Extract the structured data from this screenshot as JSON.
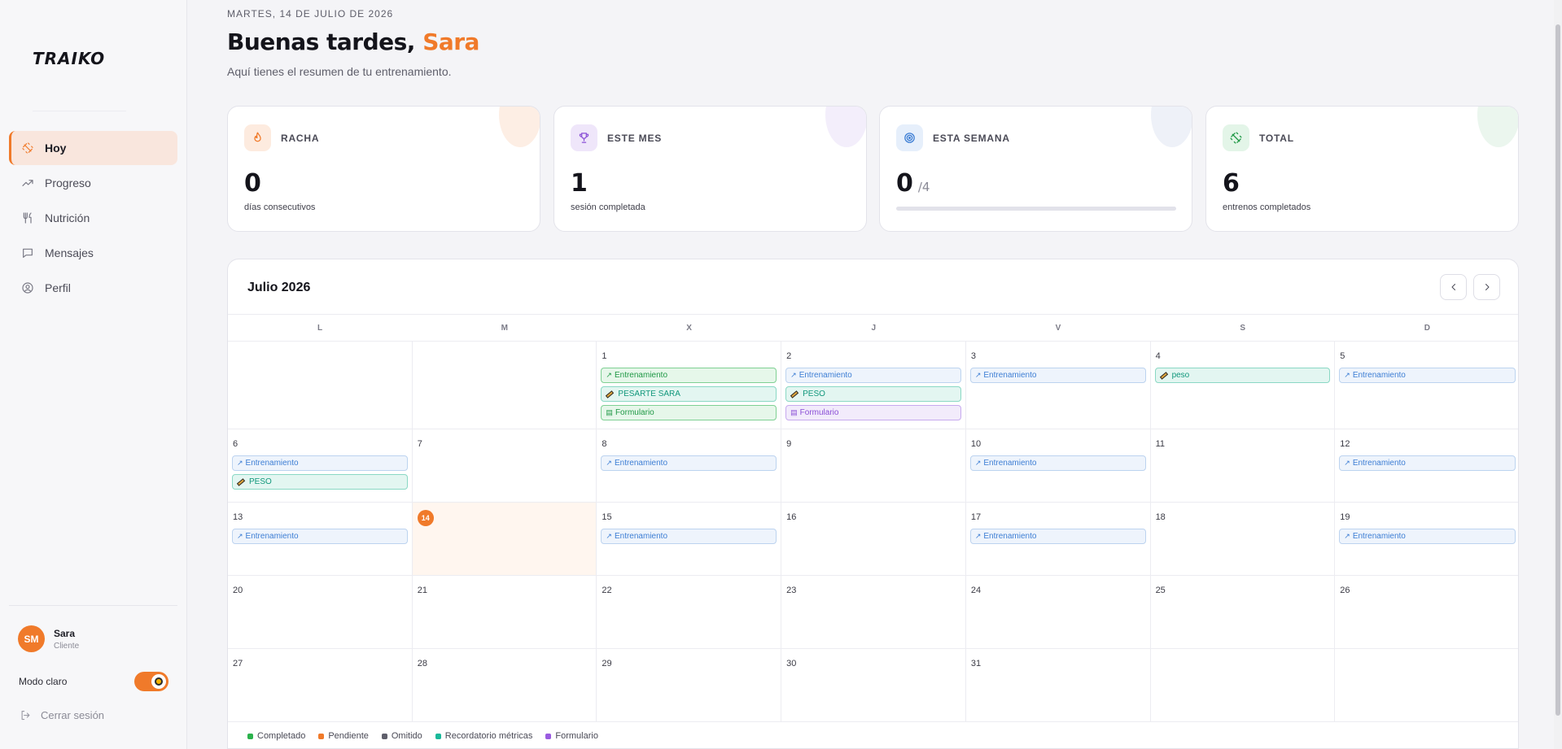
{
  "app": {
    "logo": "TRAIKO"
  },
  "sidebar": {
    "items": [
      {
        "label": "Hoy",
        "icon": "dumbbell-icon",
        "active": true
      },
      {
        "label": "Progreso",
        "icon": "trending-up-icon",
        "active": false
      },
      {
        "label": "Nutrición",
        "icon": "utensils-icon",
        "active": false
      },
      {
        "label": "Mensajes",
        "icon": "message-icon",
        "active": false
      },
      {
        "label": "Perfil",
        "icon": "user-circle-icon",
        "active": false
      }
    ],
    "user": {
      "initials": "SM",
      "name": "Sara",
      "role": "Cliente"
    },
    "theme_label": "Modo claro",
    "logout_label": "Cerrar sesión"
  },
  "header": {
    "date": "MARTES, 14 DE JULIO DE 2026",
    "greeting": "Buenas tardes,",
    "name": "Sara",
    "subtitle": "Aquí tienes el resumen de tu entrenamiento."
  },
  "stats": {
    "streak": {
      "title": "RACHA",
      "value": "0",
      "desc": "días consecutivos",
      "icon": "flame-icon",
      "color": "#f07a2a"
    },
    "month": {
      "title": "ESTE MES",
      "value": "1",
      "desc": "sesión completada",
      "icon": "trophy-icon",
      "color": "#8a4fd6"
    },
    "week": {
      "title": "ESTA SEMANA",
      "value": "0",
      "of": "/4",
      "progress": 0,
      "icon": "target-icon",
      "color": "#3d7ed4"
    },
    "total": {
      "title": "TOTAL",
      "value": "6",
      "desc": "entrenos completados",
      "icon": "dumbbell-icon",
      "color": "#1f9845"
    }
  },
  "calendar": {
    "title": "Julio 2026",
    "weekdays": [
      "L",
      "M",
      "X",
      "J",
      "V",
      "S",
      "D"
    ],
    "days": [
      {
        "n": "",
        "events": []
      },
      {
        "n": "",
        "events": []
      },
      {
        "n": "1",
        "events": [
          {
            "type": "done",
            "label": "Entrenamiento"
          },
          {
            "type": "metric",
            "label": "PESARTE SARA"
          },
          {
            "type": "done-form",
            "label": "Formulario"
          }
        ]
      },
      {
        "n": "2",
        "events": [
          {
            "type": "train",
            "label": "Entrenamiento"
          },
          {
            "type": "metric",
            "label": "PESO"
          },
          {
            "type": "form",
            "label": "Formulario"
          }
        ]
      },
      {
        "n": "3",
        "events": [
          {
            "type": "train",
            "label": "Entrenamiento"
          }
        ]
      },
      {
        "n": "4",
        "events": [
          {
            "type": "metric",
            "label": "peso"
          }
        ]
      },
      {
        "n": "5",
        "events": [
          {
            "type": "train",
            "label": "Entrenamiento"
          }
        ]
      },
      {
        "n": "6",
        "events": [
          {
            "type": "train",
            "label": "Entrenamiento"
          },
          {
            "type": "metric",
            "label": "PESO"
          }
        ]
      },
      {
        "n": "7",
        "events": []
      },
      {
        "n": "8",
        "events": [
          {
            "type": "train",
            "label": "Entrenamiento"
          }
        ]
      },
      {
        "n": "9",
        "events": []
      },
      {
        "n": "10",
        "events": [
          {
            "type": "train",
            "label": "Entrenamiento"
          }
        ]
      },
      {
        "n": "11",
        "events": []
      },
      {
        "n": "12",
        "events": [
          {
            "type": "train",
            "label": "Entrenamiento"
          }
        ]
      },
      {
        "n": "13",
        "events": [
          {
            "type": "train",
            "label": "Entrenamiento"
          }
        ]
      },
      {
        "n": "14",
        "today": true,
        "events": []
      },
      {
        "n": "15",
        "events": [
          {
            "type": "train",
            "label": "Entrenamiento"
          }
        ]
      },
      {
        "n": "16",
        "events": []
      },
      {
        "n": "17",
        "events": [
          {
            "type": "train",
            "label": "Entrenamiento"
          }
        ]
      },
      {
        "n": "18",
        "events": []
      },
      {
        "n": "19",
        "events": [
          {
            "type": "train",
            "label": "Entrenamiento"
          }
        ]
      },
      {
        "n": "20",
        "events": []
      },
      {
        "n": "21",
        "events": []
      },
      {
        "n": "22",
        "events": []
      },
      {
        "n": "23",
        "events": []
      },
      {
        "n": "24",
        "events": []
      },
      {
        "n": "25",
        "events": []
      },
      {
        "n": "26",
        "events": []
      },
      {
        "n": "27",
        "events": []
      },
      {
        "n": "28",
        "events": []
      },
      {
        "n": "29",
        "events": []
      },
      {
        "n": "30",
        "events": []
      },
      {
        "n": "31",
        "events": []
      },
      {
        "n": "",
        "events": []
      },
      {
        "n": "",
        "events": []
      }
    ],
    "legend": [
      {
        "label": "Completado",
        "color": "#2bb24c"
      },
      {
        "label": "Pendiente",
        "color": "#f07a2a"
      },
      {
        "label": "Omitido",
        "color": "#5f5f6b"
      },
      {
        "label": "Recordatorio métricas",
        "color": "#1ab99a"
      },
      {
        "label": "Formulario",
        "color": "#9a5be0"
      }
    ]
  }
}
